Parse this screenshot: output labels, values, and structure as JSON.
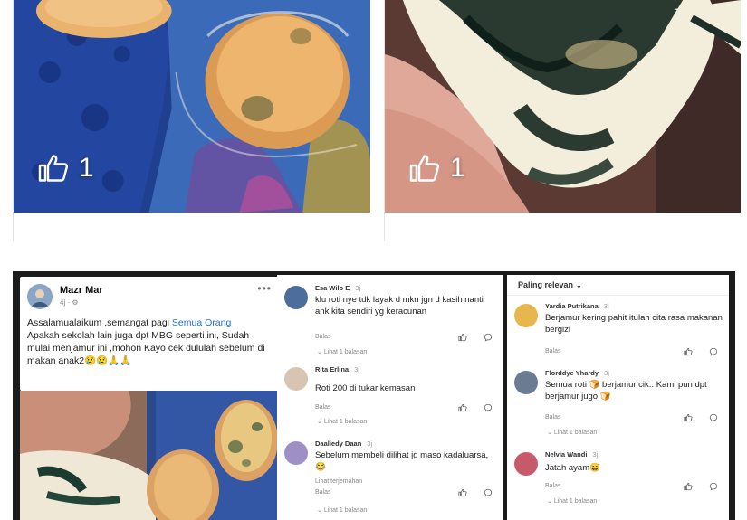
{
  "top_cards": [
    {
      "like_count": "1"
    },
    {
      "like_count": "1"
    }
  ],
  "post": {
    "author": "Mazr Mar",
    "time": "4j · ⚙",
    "more": "•••",
    "text_line1": "Assalamualaikum ,semangat pagi",
    "mention": "Semua Orang",
    "text_line2": "Apakah sekolah lain juga dpt MBG seperti ini, Sudah mulai menjamur ini ,mohon Kayo cek dululah sebelum di makan  anak2😢😢🙏🙏"
  },
  "comments_mid": [
    {
      "name": "Esa Wilo E",
      "time": "3j",
      "text": "klu roti nye tdk layak d mkn jgn d kasih nanti ank kita sendiri yg keracunan",
      "reply": "Balas",
      "more": "Lihat 1 balasan"
    },
    {
      "name": "Rita Erlina",
      "time": "3j",
      "text": "Roti 200 di tukar kemasan",
      "reply": "Balas",
      "more": "Lihat 1 balasan"
    },
    {
      "name": "Daaliedy Daan",
      "time": "3j",
      "text": "Sebelum membeli dilihat jg maso kadaluarsa, 😂",
      "status": "Lihat terjemahan",
      "reply": "Balas",
      "more": "Lihat 1 balasan"
    }
  ],
  "comments_right": {
    "sort_label": "Paling relevan",
    "items": [
      {
        "name": "Yardia Putrikana",
        "time": "3j",
        "text": "Berjamur kering pahit itulah cita rasa makanan bergizi",
        "reply": "Balas"
      },
      {
        "name": "Florddye Yhardy",
        "time": "3j",
        "text": "Semua roti 🍞 berjamur cik.. Kami pun dpt berjamur jugo 🍞",
        "reply": "Balas",
        "more": "Lihat 1 balasan"
      },
      {
        "name": "Nelvia Wandi",
        "time": "3j",
        "text": "Jatah ayam😄",
        "reply": "Balas",
        "more": "Lihat 1 balasan"
      }
    ]
  },
  "colors": {
    "link_blue": "#1d6fd1",
    "card_border": "#e3e3e3"
  }
}
